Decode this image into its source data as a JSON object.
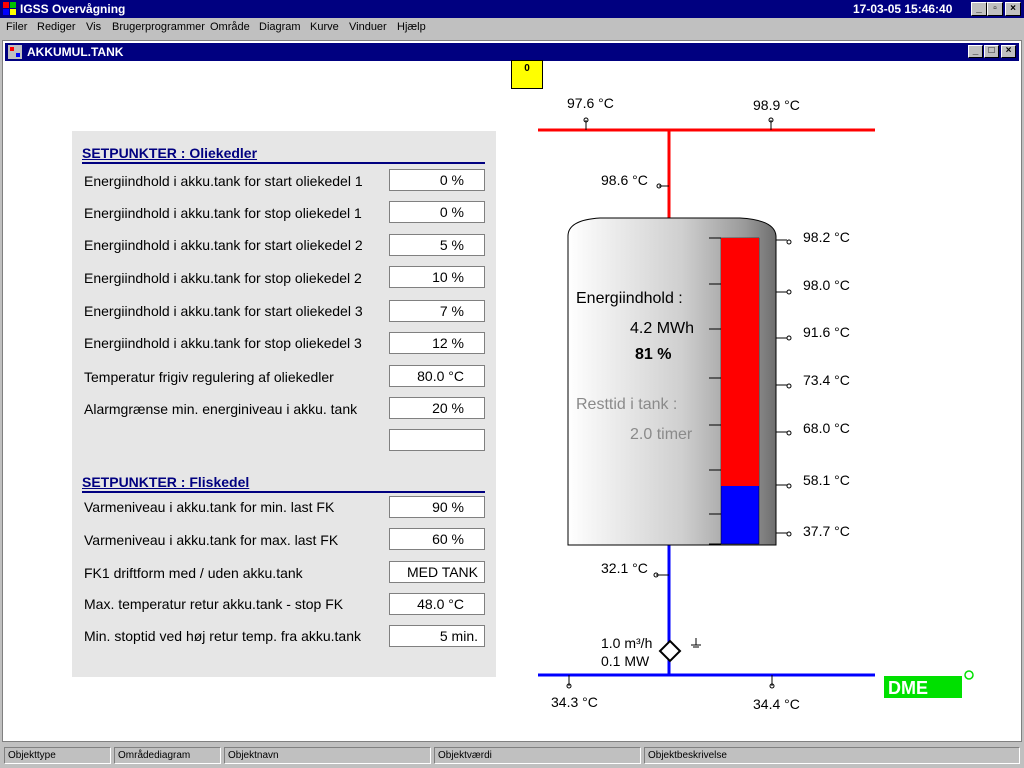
{
  "app": {
    "title": "IGSS Overvågning",
    "datetime": "17-03-05  15:46:40"
  },
  "menu": [
    "Filer",
    "Rediger",
    "Vis",
    "Brugerprogrammer",
    "Område",
    "Diagram",
    "Kurve",
    "Vinduer",
    "Hjælp"
  ],
  "window": {
    "title": "AKKUMUL.TANK",
    "alarm_count": "0"
  },
  "oil": {
    "header": "SETPUNKTER : Oliekedler",
    "rows": [
      {
        "label": "Energiindhold i akku.tank for start oliekedel 1",
        "value": "0 %"
      },
      {
        "label": "Energiindhold i akku.tank for stop oliekedel 1",
        "value": "0 %"
      },
      {
        "label": "Energiindhold i akku.tank for start oliekedel 2",
        "value": "5 %"
      },
      {
        "label": "Energiindhold i akku.tank for stop oliekedel 2",
        "value": "10 %"
      },
      {
        "label": "Energiindhold i akku.tank for start oliekedel 3",
        "value": "7 %"
      },
      {
        "label": "Energiindhold i akku.tank for stop oliekedel 3",
        "value": "12 %"
      },
      {
        "label": "Temperatur frigiv regulering af oliekedler",
        "value": "80.0 °C"
      },
      {
        "label": "Alarmgrænse min. energiniveau i akku. tank",
        "value": "20 %"
      },
      {
        "label": "",
        "value": ""
      }
    ]
  },
  "chip": {
    "header": "SETPUNKTER : Fliskedel",
    "rows": [
      {
        "label": "Varmeniveau i akku.tank for min. last FK",
        "value": "90 %"
      },
      {
        "label": "Varmeniveau i akku.tank for max. last FK",
        "value": "60 %"
      },
      {
        "label": "FK1 driftform med / uden akku.tank",
        "value": "MED TANK"
      },
      {
        "label": "Max. temperatur retur akku.tank - stop FK",
        "value": "48.0 °C"
      },
      {
        "label": "Min. stoptid ved høj retur temp. fra akku.tank",
        "value": "5 min."
      }
    ]
  },
  "tank": {
    "supply_left": "97.6 °C",
    "supply_right": "98.9 °C",
    "inlet": "98.6 °C",
    "energy_label": "Energiindhold :",
    "energy_mwh": "4.2 MWh",
    "energy_pct": "81 %",
    "remaining_label": "Resttid i tank :",
    "remaining_value": "2.0 timer",
    "level_fraction": 0.81,
    "sensors": [
      "98.2 °C",
      "98.0 °C",
      "91.6 °C",
      "73.4 °C",
      "68.0 °C",
      "58.1 °C",
      "37.7 °C"
    ],
    "outlet": "32.1 °C",
    "flow": "1.0 m³/h",
    "power": "0.1 MW",
    "return_left": "34.3 °C",
    "return_right": "34.4 °C",
    "colors": {
      "hot": "#ff0000",
      "cold": "#0000ff",
      "logo": "#00e000"
    }
  },
  "status": [
    "Objekttype",
    "Områdediagram",
    "Objektnavn",
    "Objektværdi",
    "Objektbeskrivelse"
  ]
}
